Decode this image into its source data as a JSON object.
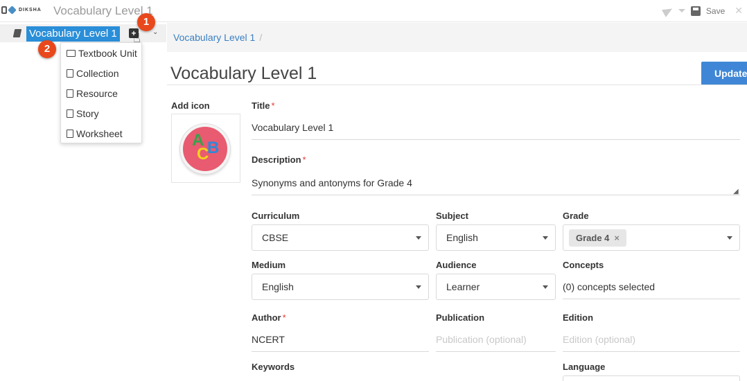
{
  "topbar": {
    "logo_text": "DIKSHA",
    "app_title": "Vocabulary Level 1",
    "save_label": "Save",
    "close_glyph": "✕"
  },
  "sidebar": {
    "tree_label": "Vocabulary Level 1",
    "add_glyph": "+",
    "expand_glyph": "⌄",
    "badges": [
      "1",
      "2"
    ],
    "menu_items": [
      {
        "label": "Textbook Unit",
        "icon": "folder-icon"
      },
      {
        "label": "Collection",
        "icon": "file-icon"
      },
      {
        "label": "Resource",
        "icon": "file-icon"
      },
      {
        "label": "Story",
        "icon": "file-icon"
      },
      {
        "label": "Worksheet",
        "icon": "file-icon"
      }
    ]
  },
  "main": {
    "breadcrumb": "Vocabulary Level 1",
    "breadcrumb_sep": "/",
    "page_title": "Vocabulary Level 1",
    "update_label": "Update",
    "add_icon_label": "Add icon",
    "icon_letters": [
      "A",
      "C",
      "B"
    ],
    "required_mark": "*",
    "fields": {
      "title": {
        "label": "Title",
        "value": "Vocabulary Level 1"
      },
      "description": {
        "label": "Description",
        "value": "Synonyms and antonyms for Grade 4"
      },
      "curriculum": {
        "label": "Curriculum",
        "value": "CBSE"
      },
      "subject": {
        "label": "Subject",
        "value": "English"
      },
      "grade": {
        "label": "Grade",
        "chip": "Grade 4",
        "chip_remove": "×"
      },
      "medium": {
        "label": "Medium",
        "value": "English"
      },
      "audience": {
        "label": "Audience",
        "value": "Learner"
      },
      "concepts": {
        "label": "Concepts",
        "value": "(0) concepts selected"
      },
      "author": {
        "label": "Author",
        "value": "NCERT"
      },
      "publication": {
        "label": "Publication",
        "placeholder": "Publication (optional)"
      },
      "edition": {
        "label": "Edition",
        "placeholder": "Edition (optional)"
      },
      "keywords": {
        "label": "Keywords"
      },
      "language": {
        "label": "Language"
      }
    }
  },
  "colors": {
    "accent": "#2a8ed8",
    "update_button": "#3f87d6",
    "badge": "#e8481c",
    "required": "#e53935"
  }
}
